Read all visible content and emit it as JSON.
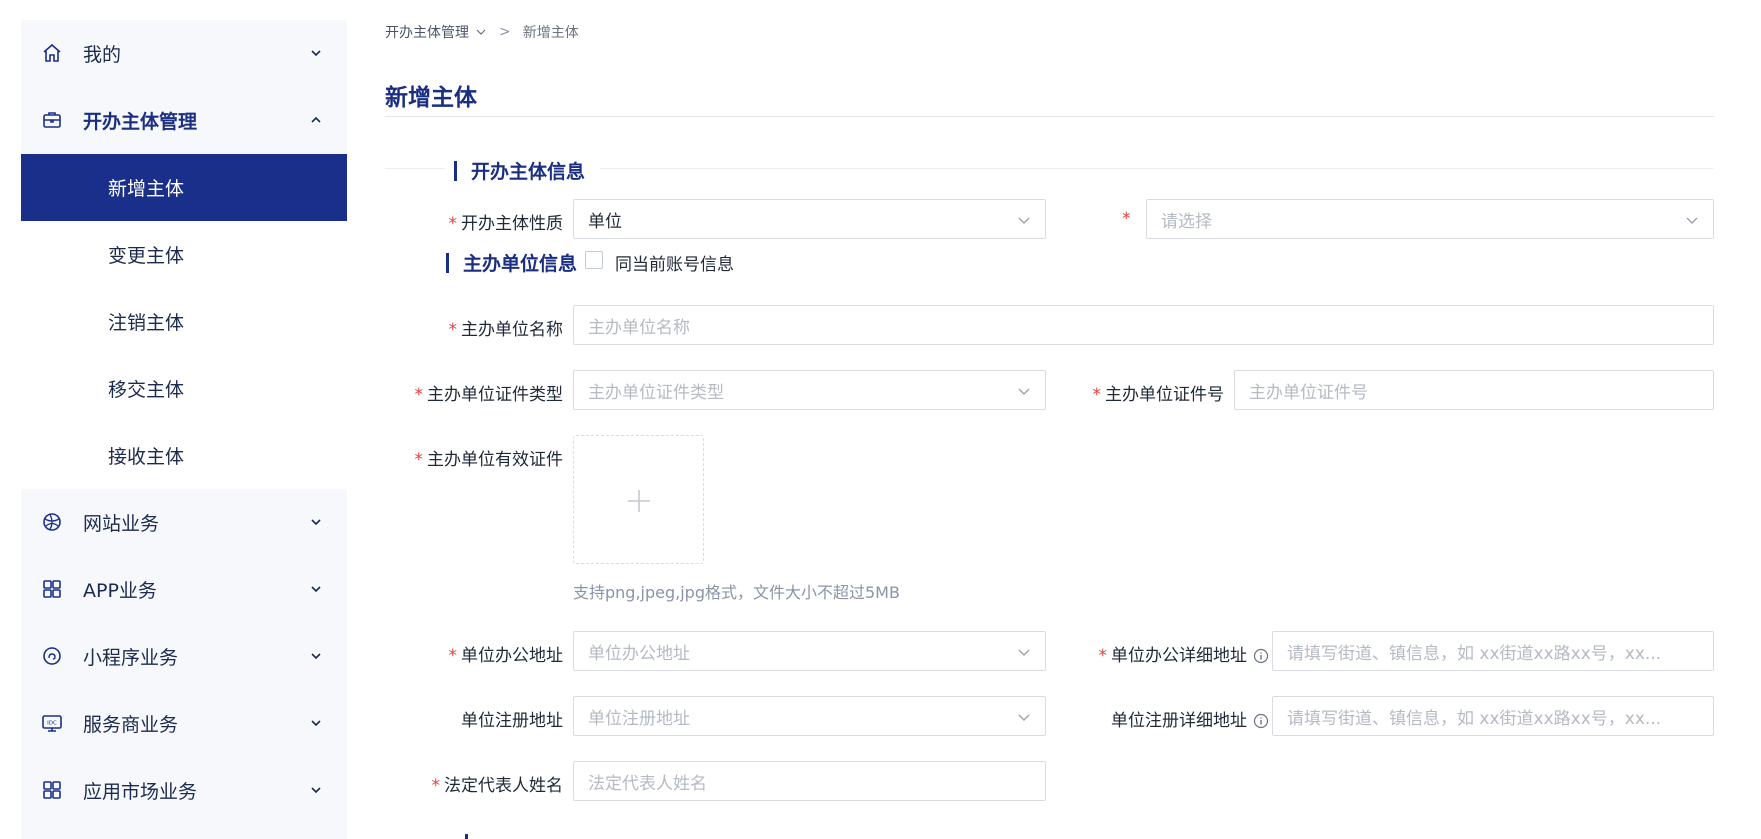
{
  "sidebar": {
    "items": [
      {
        "label": "我的",
        "icon": "home-icon",
        "expanded": false
      },
      {
        "label": "开办主体管理",
        "icon": "briefcase-icon",
        "expanded": true,
        "children": [
          {
            "label": "新增主体",
            "active": true
          },
          {
            "label": "变更主体"
          },
          {
            "label": "注销主体"
          },
          {
            "label": "移交主体"
          },
          {
            "label": "接收主体"
          }
        ]
      },
      {
        "label": "网站业务",
        "icon": "globe-icon",
        "expanded": false
      },
      {
        "label": "APP业务",
        "icon": "app-grid-icon",
        "expanded": false
      },
      {
        "label": "小程序业务",
        "icon": "mini-program-icon",
        "expanded": false
      },
      {
        "label": "服务商业务",
        "icon": "idc-icon",
        "expanded": false
      },
      {
        "label": "应用市场业务",
        "icon": "app-grid-icon",
        "expanded": false
      }
    ]
  },
  "breadcrumb": {
    "parent": "开办主体管理",
    "separator": ">",
    "current": "新增主体"
  },
  "page": {
    "title": "新增主体"
  },
  "sections": {
    "subject_info": {
      "title": "开办主体信息"
    },
    "host_unit_info": {
      "title": "主办单位信息",
      "same_as_account_label": "同当前账号信息"
    }
  },
  "form": {
    "subject_nature": {
      "label": "开办主体性质",
      "value": "单位",
      "required": true
    },
    "subject_type": {
      "placeholder": "请选择",
      "required": true
    },
    "host_unit_name": {
      "label": "主办单位名称",
      "placeholder": "主办单位名称",
      "required": true
    },
    "cert_type": {
      "label": "主办单位证件类型",
      "placeholder": "主办单位证件类型",
      "required": true
    },
    "cert_number": {
      "label": "主办单位证件号",
      "placeholder": "主办单位证件号",
      "required": true
    },
    "valid_cert": {
      "label": "主办单位有效证件",
      "required": true,
      "hint": "支持png,jpeg,jpg格式，文件大小不超过5MB"
    },
    "office_address": {
      "label": "单位办公地址",
      "placeholder": "单位办公地址",
      "required": true
    },
    "office_detail": {
      "label": "单位办公详细地址",
      "placeholder": "请填写街道、镇信息，如 xx街道xx路xx号，xx...",
      "required": true
    },
    "reg_address": {
      "label": "单位注册地址",
      "placeholder": "单位注册地址",
      "required": false
    },
    "reg_detail": {
      "label": "单位注册详细地址",
      "placeholder": "请填写街道、镇信息，如 xx街道xx路xx号，xx...",
      "required": false
    },
    "legal_rep": {
      "label": "法定代表人姓名",
      "placeholder": "法定代表人姓名",
      "required": true
    }
  },
  "colors": {
    "accent": "#1a2f8a",
    "required": "#e53e3e",
    "sidebar_bg": "#f6f8fc"
  }
}
